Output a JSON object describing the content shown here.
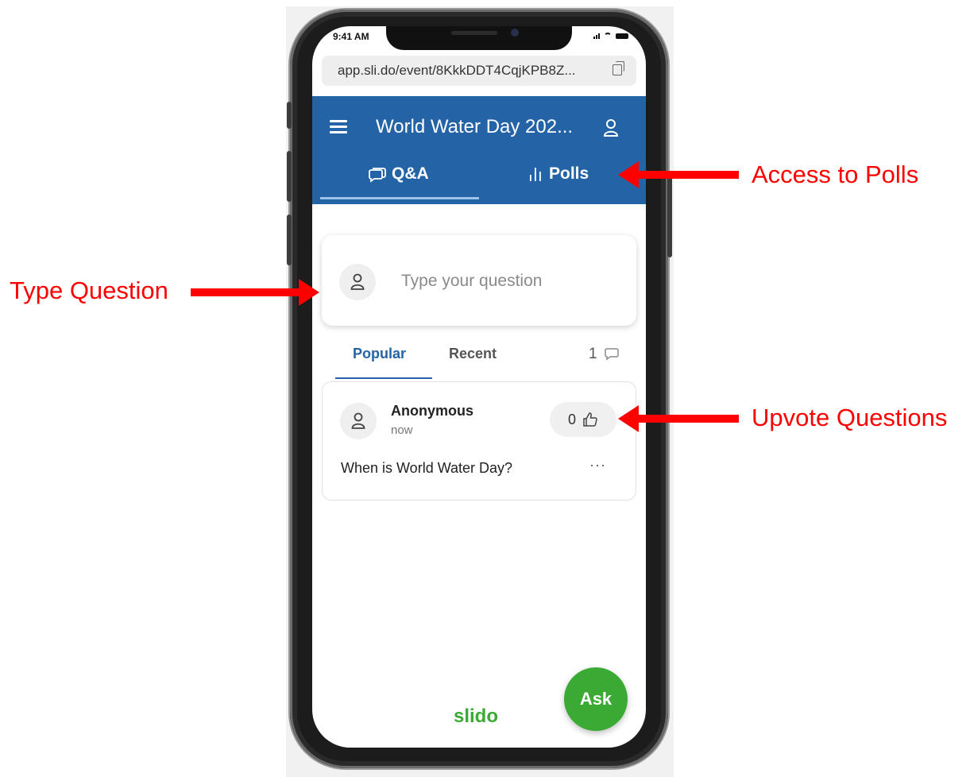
{
  "status": {
    "time": "9:41 AM"
  },
  "browser": {
    "url": "app.sli.do/event/8KkkDDT4CqjKPB8Z..."
  },
  "header": {
    "title": "World Water Day 202...",
    "tabs": [
      {
        "label": "Q&A",
        "icon": "speech-bubble-icon",
        "active": true
      },
      {
        "label": "Polls",
        "icon": "bar-chart-icon",
        "active": false
      }
    ]
  },
  "ask": {
    "placeholder": "Type your question"
  },
  "sort": {
    "popular": "Popular",
    "recent": "Recent",
    "count": "1"
  },
  "questions": [
    {
      "author": "Anonymous",
      "time": "now",
      "text": "When is World Water Day?",
      "votes": "0",
      "more": "···"
    }
  ],
  "brand": "slido",
  "fab": {
    "label": "Ask"
  },
  "annotations": {
    "polls": "Access to Polls",
    "type": "Type Question",
    "upvote": "Upvote Questions"
  },
  "colors": {
    "header": "#2464a6",
    "brand_green": "#3aaa35",
    "annotation_red": "#ff0000"
  }
}
